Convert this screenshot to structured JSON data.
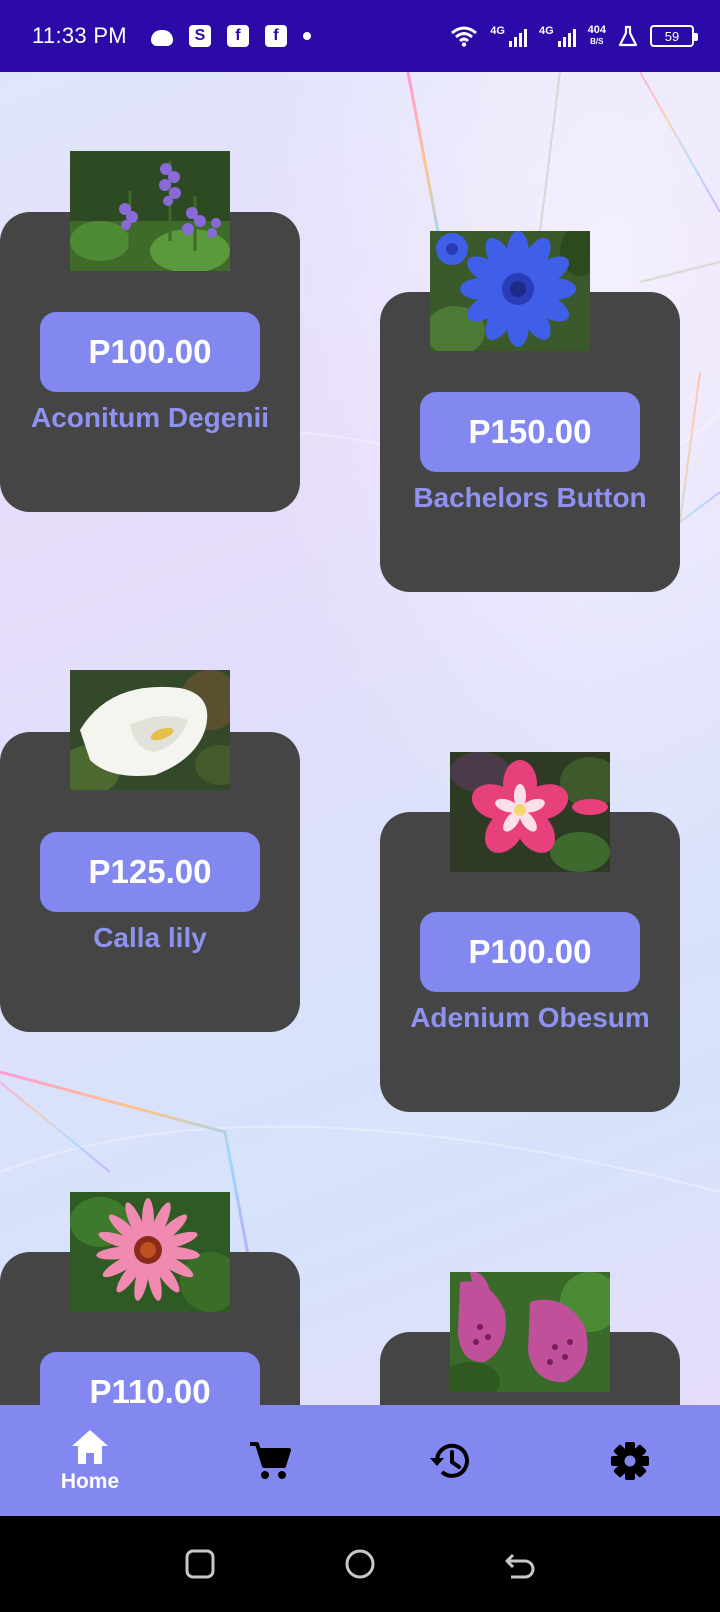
{
  "status_bar": {
    "time": "11:33 PM",
    "network_1": "4G",
    "network_2": "4G",
    "speed_value": "404",
    "speed_unit": "B/S",
    "battery": "59"
  },
  "products": [
    {
      "name": "Aconitum Degenii",
      "price": "P100.00",
      "image": "purple-aconitum-flowers"
    },
    {
      "name": "Bachelors Button",
      "price": "P150.00",
      "image": "blue-cornflower"
    },
    {
      "name": "Calla lily",
      "price": "P125.00",
      "image": "white-calla-lily"
    },
    {
      "name": "Adenium Obesum",
      "price": "P100.00",
      "image": "pink-adenium-flower"
    },
    {
      "name": "",
      "price": "P110.00",
      "image": "pink-echinacea-flower"
    },
    {
      "name": "",
      "price": "",
      "image": "pink-foxglove-flowers"
    }
  ],
  "bottom_nav": {
    "items": [
      {
        "label": "Home",
        "icon": "home-icon",
        "active": true
      },
      {
        "label": "",
        "icon": "cart-icon"
      },
      {
        "label": "",
        "icon": "history-icon"
      },
      {
        "label": "",
        "icon": "settings-icon"
      }
    ]
  },
  "colors": {
    "status_bar": "#2c0aa8",
    "card": "#454545",
    "accent": "#8288f0",
    "name_text": "#8f92f0"
  }
}
